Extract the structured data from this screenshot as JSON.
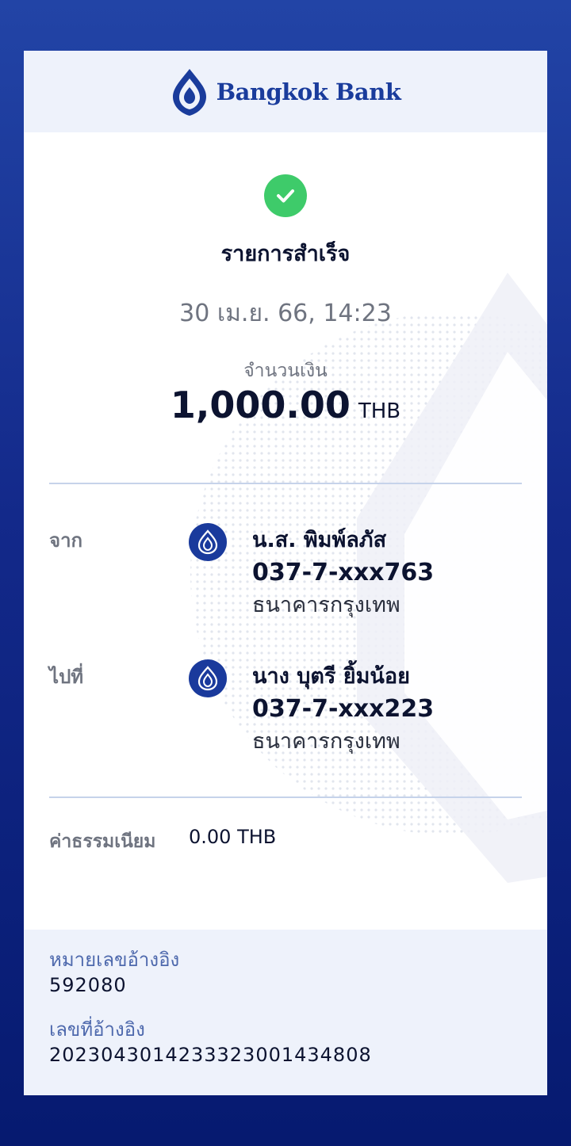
{
  "brand": {
    "name": "Bangkok Bank",
    "logo_icon": "bangkok-bank-lotus-icon",
    "color": "#1a3c9c"
  },
  "status": {
    "icon": "check-icon",
    "title": "รายการสำเร็จ",
    "color": "#3ecb6a"
  },
  "datetime": "30 เม.ย. 66, 14:23",
  "amount": {
    "label": "จำนวนเงิน",
    "value": "1,000.00",
    "currency": "THB"
  },
  "from": {
    "label": "จาก",
    "name": "น.ส. พิมพ์ลภัส",
    "account": "037-7-xxx763",
    "bank": "ธนาคารกรุงเทพ"
  },
  "to": {
    "label": "ไปที่",
    "name": "นาง บุตรี ยิ้มน้อย",
    "account": "037-7-xxx223",
    "bank": "ธนาคารกรุงเทพ"
  },
  "fee": {
    "label": "ค่าธรรมเนียม",
    "value": "0.00 THB"
  },
  "reference": {
    "ref_no_label": "หมายเลขอ้างอิง",
    "ref_no": "592080",
    "ref_id_label": "เลขที่อ้างอิง",
    "ref_id": "2023043014233323001434808"
  }
}
